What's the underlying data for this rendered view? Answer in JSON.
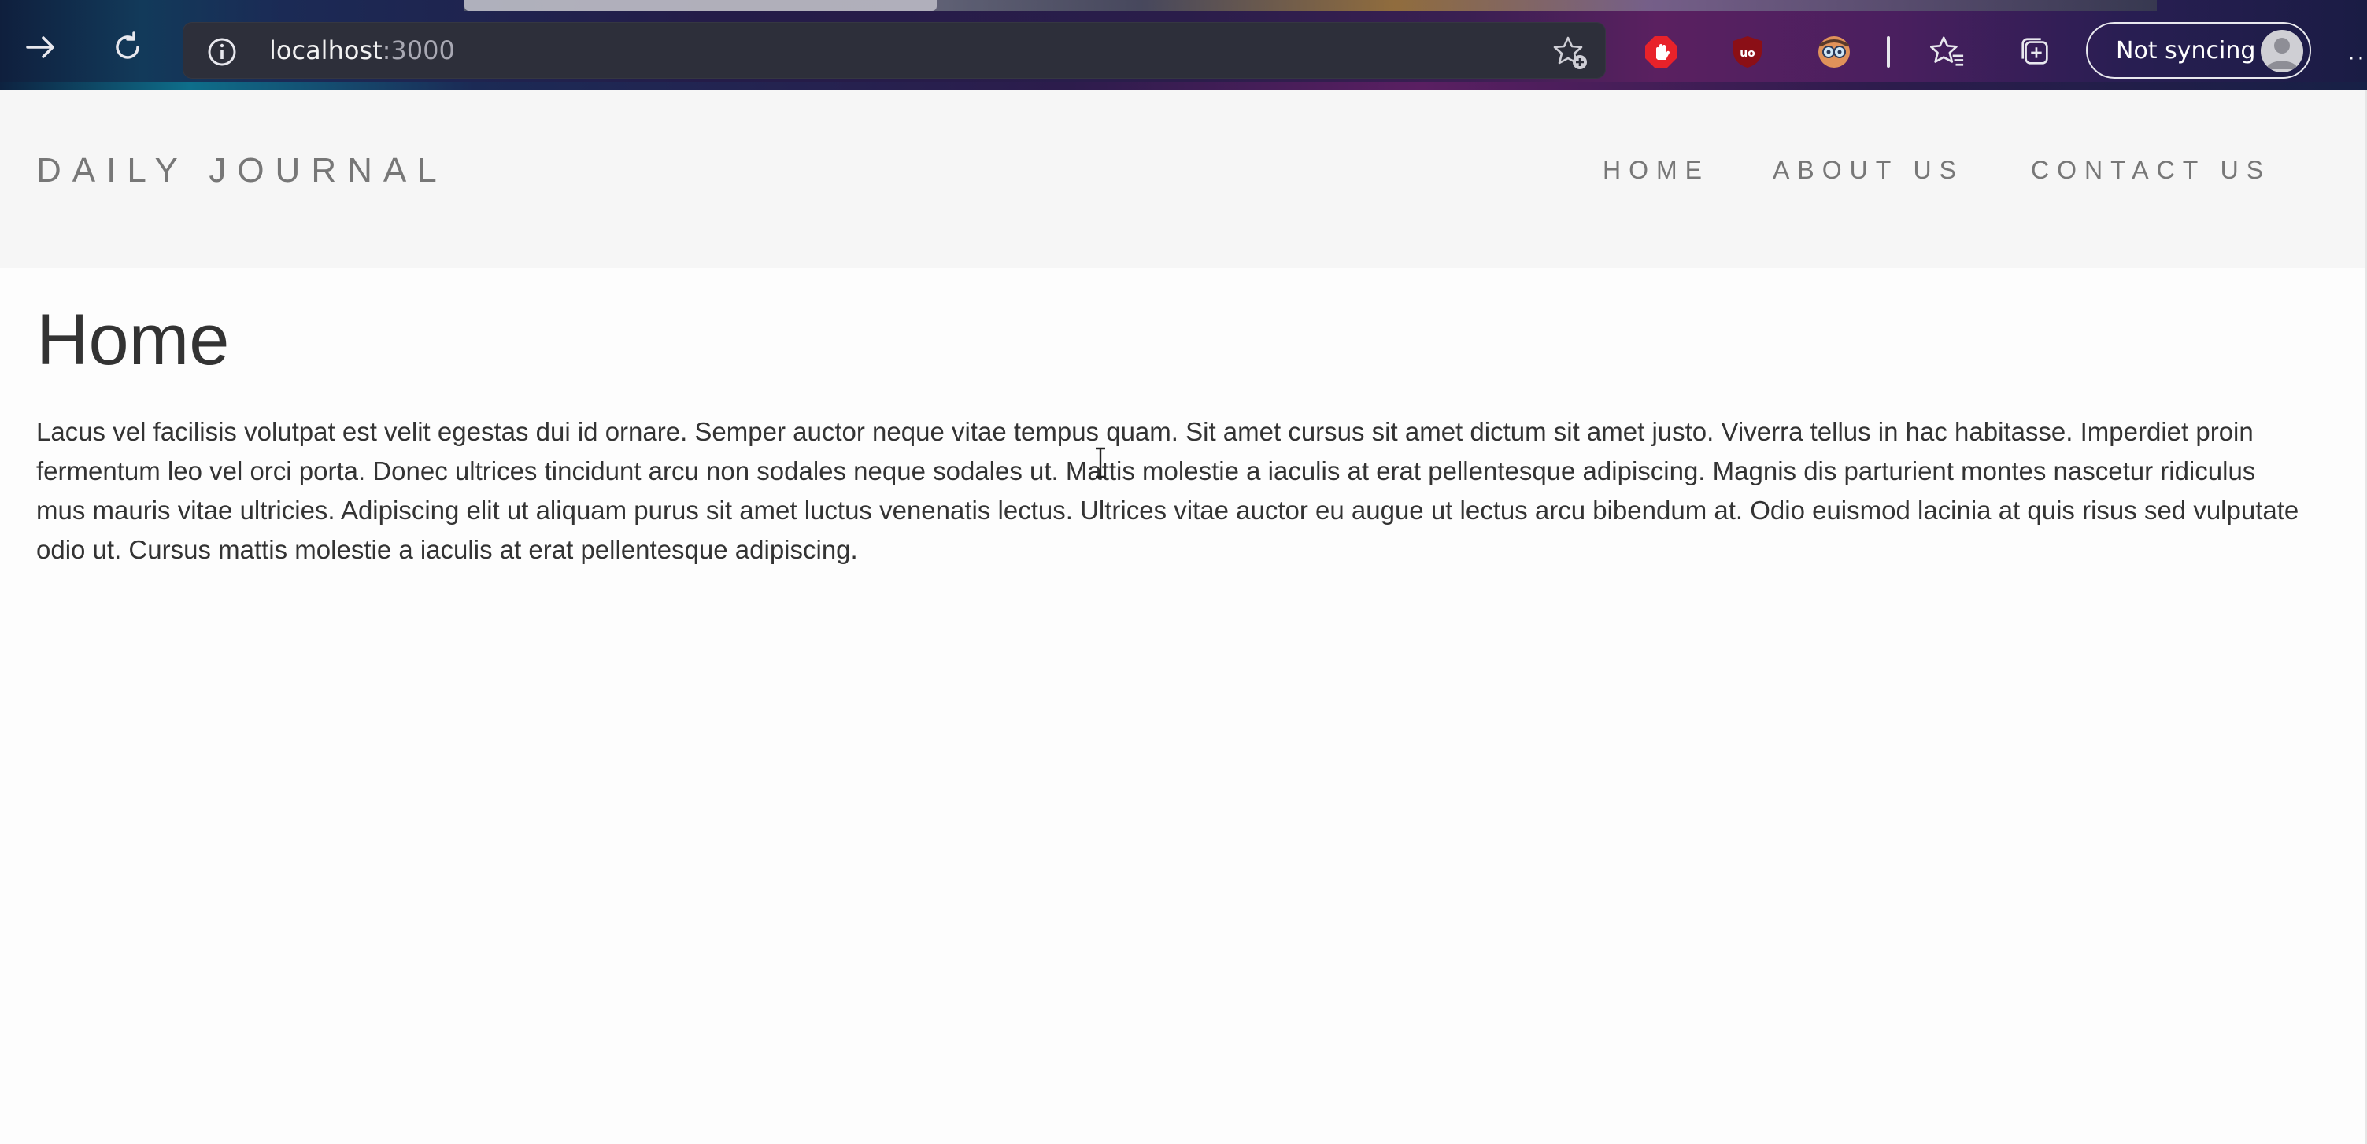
{
  "browser": {
    "url_host": "localhost",
    "url_port": ":3000",
    "sync_label": "Not syncing",
    "icons": {
      "forward": "forward-arrow-icon",
      "refresh": "refresh-icon",
      "info": "site-info-icon",
      "add_favorite": "add-favorite-icon",
      "ext_adblock": "adblock-extension-icon",
      "ext_ublock": "ublock-origin-icon",
      "ext_glasses": "reader-extension-icon",
      "favorites": "favorites-icon",
      "collections": "collections-icon",
      "profile": "profile-avatar-icon",
      "more": "more-menu-icon"
    },
    "colors": {
      "adblock": "#e8222a",
      "ublock": "#8b0f16"
    }
  },
  "site": {
    "brand": "DAILY JOURNAL",
    "nav": [
      {
        "label": "HOME"
      },
      {
        "label": "ABOUT US"
      },
      {
        "label": "CONTACT US"
      }
    ]
  },
  "page": {
    "title": "Home",
    "body": "Lacus vel facilisis volutpat est velit egestas dui id ornare. Semper auctor neque vitae tempus quam. Sit amet cursus sit amet dictum sit amet justo. Viverra tellus in hac habitasse. Imperdiet proin fermentum leo vel orci porta. Donec ultrices tincidunt arcu non sodales neque sodales ut. Mattis molestie a iaculis at erat pellentesque adipiscing. Magnis dis parturient montes nascetur ridiculus mus mauris vitae ultricies. Adipiscing elit ut aliquam purus sit amet luctus venenatis lectus. Ultrices vitae auctor eu augue ut lectus arcu bibendum at. Odio euismod lacinia at quis risus sed vulputate odio ut. Cursus mattis molestie a iaculis at erat pellentesque adipiscing."
  }
}
